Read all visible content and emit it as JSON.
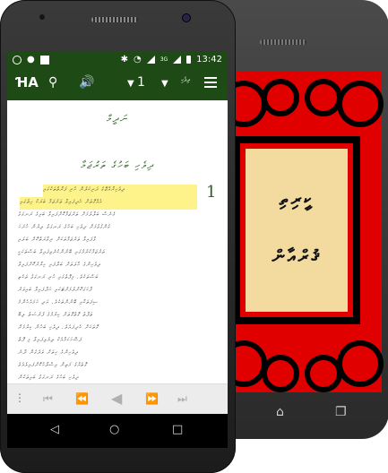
{
  "status_bar": {
    "time": "13:42",
    "network": "3G"
  },
  "toolbar": {
    "font_size_label": "ꞪA",
    "chapter_number": "1",
    "book_abbrev": "ދިވެހި"
  },
  "reader": {
    "chapter_heading": "ނަދީމް",
    "section_heading": "ދިވެހި ބަހުގެ ތަރުޖަމާ",
    "verse_number": "1",
    "highlight_color": "#fdf38a",
    "heading_color": "#2d5e21",
    "text_lines": [
      "ދިވެހިރާއްޖޭގެ ދަރިކަލުން ހުރި ފަރާތްތަކުގައި",
      "އެއްގޮތަށް ހެދިފައިވާ ތަރުޖަމާ ބަޔަކު ހިތުގައި",
      "ގެނެސް ބަލާލުމަށް ތަރުޖަމާކޮށްފައިވާ ބައިގެ ރަނގަޅު",
      "ގެންގުޅުމަށް ދިވެހި ބަހުގެ ރަނގަޅު ލިޔުން ހުށަހަ",
      "ޅާފައިވާ ތަރުޖަމާތަކަށް ރިޢާޔަތްކޮށް ބަލައި",
      "ތަރުޖަމާކުރުމުގައި ބޭނުންކުރެވިފައިވާ ބަސްތަކަކީ",
      "ދިވެހިންގެ ހާލަތަށް ބަލާފައި ހިޔާރުކޮށްފައިވާ",
      "ބަސްތަކެވެ. މިފޮތުގައި ހުރި ރަނގަޅު ތަކެތި",
      "ފާހަގަކޮށްލުމަށްޓަކައި ހަދާފައިވާ ބައިވަރު",
      "ސިފަތަކާއި ބޭނުންތަކެވެ. އަދި ހަމައެހެންމެ",
      "ތަފާތު ގޮތްގޮތަށް ކިޔުމުގެ ފުރުސަތު ލިބޭ",
      "ގޮތަކަށް ހެދިފައެވެ. ދިވެހި ބަހުން ކިޔުމަށް",
      "ފަސޭހަކަމާއެކު ލިޔެވިފައިވާ މި ފޮތް",
      "ދިވެހިންގެ ހިތަށް ވަދެގެން ދާނެ",
      "ގޮތެއްގެ މަތިން އިސްލާހުކޮށްފައިވެއެވެ",
      "ދިވެހި ބަހުގެ ރަނގަޅު ބައިތަކުން"
    ]
  },
  "back_screen": {
    "title_line1": "ކީރިތި",
    "title_line2": "ޤުރްއާން"
  }
}
